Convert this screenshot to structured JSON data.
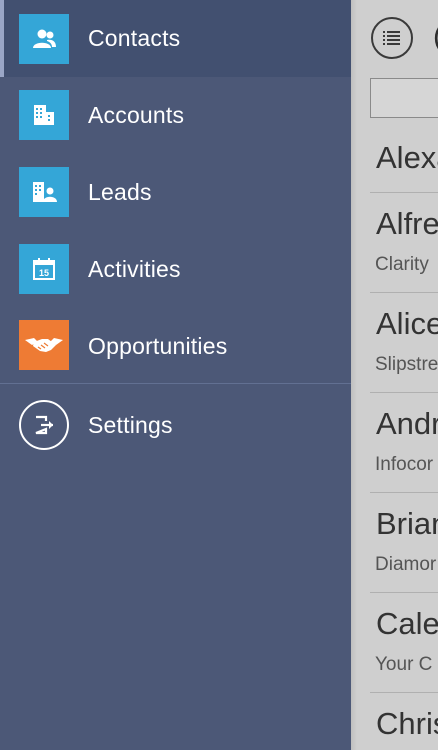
{
  "sidebar": {
    "items": [
      {
        "label": "Contacts",
        "icon": "contacts-icon",
        "tile_color": "#34a6d7",
        "active": true
      },
      {
        "label": "Accounts",
        "icon": "accounts-building-icon",
        "tile_color": "#34a6d7",
        "active": false
      },
      {
        "label": "Leads",
        "icon": "leads-icon",
        "tile_color": "#34a6d7",
        "active": false
      },
      {
        "label": "Activities",
        "icon": "calendar-icon",
        "tile_color": "#34a6d7",
        "active": false,
        "icon_text": "15"
      },
      {
        "label": "Opportunities",
        "icon": "handshake-icon",
        "tile_color": "#ee7b34",
        "active": false
      }
    ],
    "settings": {
      "label": "Settings",
      "icon": "sign-out-icon"
    }
  },
  "panel": {
    "header_glyph": "(",
    "contacts": [
      {
        "name": "Alexa",
        "company": ""
      },
      {
        "name": "Alfre",
        "company": "Clarity"
      },
      {
        "name": "Alice",
        "company": "Slipstre"
      },
      {
        "name": "Andr",
        "company": "Infocor"
      },
      {
        "name": "Brian",
        "company": "Diamor"
      },
      {
        "name": "Calel",
        "company": "Your C"
      },
      {
        "name": "Chris",
        "company": ""
      }
    ]
  },
  "colors": {
    "sidebar_bg": "#4c5877",
    "active_bg": "#425070",
    "tile_blue": "#34a6d7",
    "tile_orange": "#ee7b34",
    "panel_bg": "#cfcfcf"
  }
}
